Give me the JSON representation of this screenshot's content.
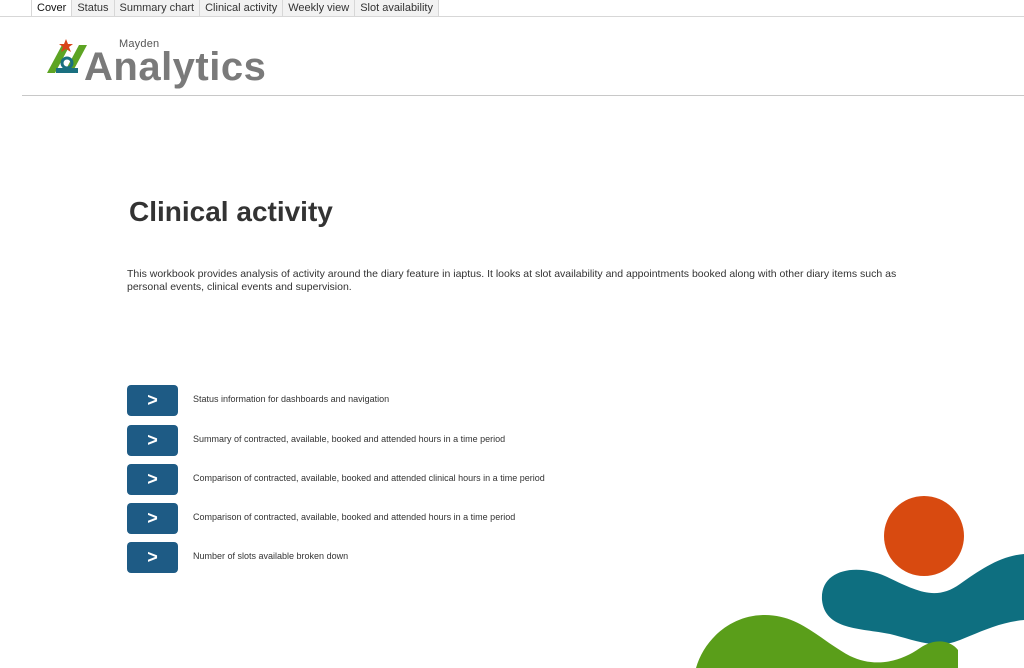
{
  "tabs": [
    {
      "label": "Cover",
      "active": true
    },
    {
      "label": "Status",
      "active": false
    },
    {
      "label": "Summary chart",
      "active": false
    },
    {
      "label": "Clinical activity",
      "active": false
    },
    {
      "label": "Weekly view",
      "active": false
    },
    {
      "label": "Slot availability",
      "active": false
    }
  ],
  "logo": {
    "small_text": "Mayden",
    "big_text": "Analytics",
    "colors": {
      "green": "#5da423",
      "red": "#d9441a",
      "teal": "#1a7080"
    }
  },
  "main": {
    "title": "Clinical activity",
    "intro": "This workbook provides analysis of activity around the diary feature in iaptus.  It looks at slot availability and appointments booked along with other diary items such as personal events, clinical events and supervision.",
    "nav_items": [
      {
        "button_glyph": ">",
        "label": "Status information for dashboards and navigation"
      },
      {
        "button_glyph": ">",
        "label": "Summary of contracted, available, booked and attended hours in a time period"
      },
      {
        "button_glyph": ">",
        "label": "Comparison of contracted, available, booked and attended clinical hours in a time period"
      },
      {
        "button_glyph": ">",
        "label": "Comparison of contracted, available, booked and attended hours in a time period"
      },
      {
        "button_glyph": ">",
        "label": "Number of slots available broken down"
      }
    ]
  },
  "decoration": {
    "colors": {
      "orange": "#d84a10",
      "teal": "#0e6f80",
      "green": "#5a9e1a"
    }
  }
}
